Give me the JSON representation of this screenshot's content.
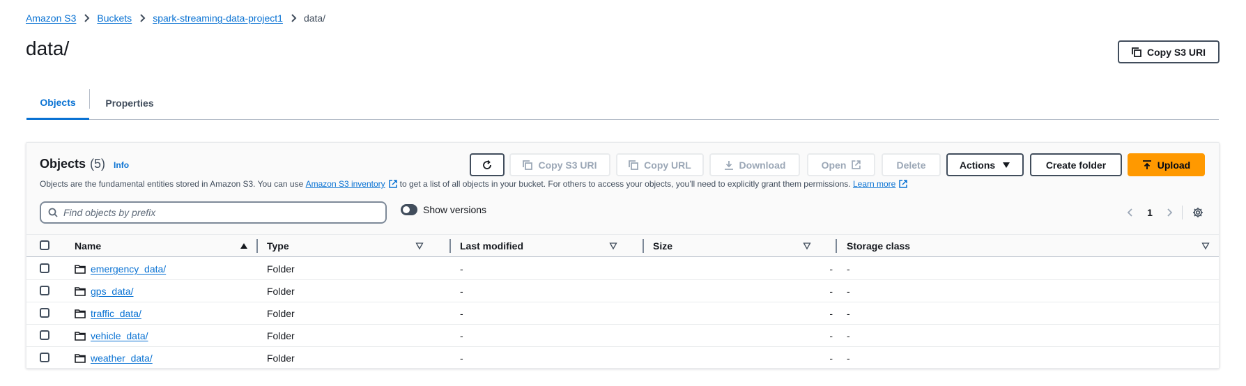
{
  "breadcrumb": {
    "items": [
      "Amazon S3",
      "Buckets",
      "spark-streaming-data-project1"
    ],
    "current": "data/"
  },
  "page": {
    "title": "data/",
    "copy_uri_label": "Copy S3 URI"
  },
  "tabs": [
    {
      "label": "Objects",
      "active": true
    },
    {
      "label": "Properties",
      "active": false
    }
  ],
  "objects_panel": {
    "title": "Objects",
    "count": "(5)",
    "info_label": "Info",
    "description": {
      "part1": "Objects are the fundamental entities stored in Amazon S3. You can use",
      "inventory_link": "Amazon S3 inventory",
      "part2": "to get a list of all objects in your bucket. For others to access your objects, you’ll need to explicitly grant them permissions.",
      "learn_more": "Learn more"
    },
    "toolbar": {
      "copy_s3_uri": "Copy S3 URI",
      "copy_url": "Copy URL",
      "download": "Download",
      "open": "Open",
      "delete": "Delete",
      "actions": "Actions",
      "create_folder": "Create folder",
      "upload": "Upload"
    },
    "search": {
      "placeholder": "Find objects by prefix",
      "value": ""
    },
    "show_versions_label": "Show versions",
    "pagination": {
      "current_page": "1"
    },
    "columns": [
      "Name",
      "Type",
      "Last modified",
      "Size",
      "Storage class"
    ],
    "rows": [
      {
        "name": "emergency_data/",
        "type": "Folder",
        "last_modified": "-",
        "size": "-",
        "storage_class": "-"
      },
      {
        "name": "gps_data/",
        "type": "Folder",
        "last_modified": "-",
        "size": "-",
        "storage_class": "-"
      },
      {
        "name": "traffic_data/",
        "type": "Folder",
        "last_modified": "-",
        "size": "-",
        "storage_class": "-"
      },
      {
        "name": "vehicle_data/",
        "type": "Folder",
        "last_modified": "-",
        "size": "-",
        "storage_class": "-"
      },
      {
        "name": "weather_data/",
        "type": "Folder",
        "last_modified": "-",
        "size": "-",
        "storage_class": "-"
      }
    ]
  },
  "colors": {
    "link": "#0972d3",
    "primary_button": "#ff9900",
    "text": "#16191f",
    "border": "#414d5c"
  }
}
